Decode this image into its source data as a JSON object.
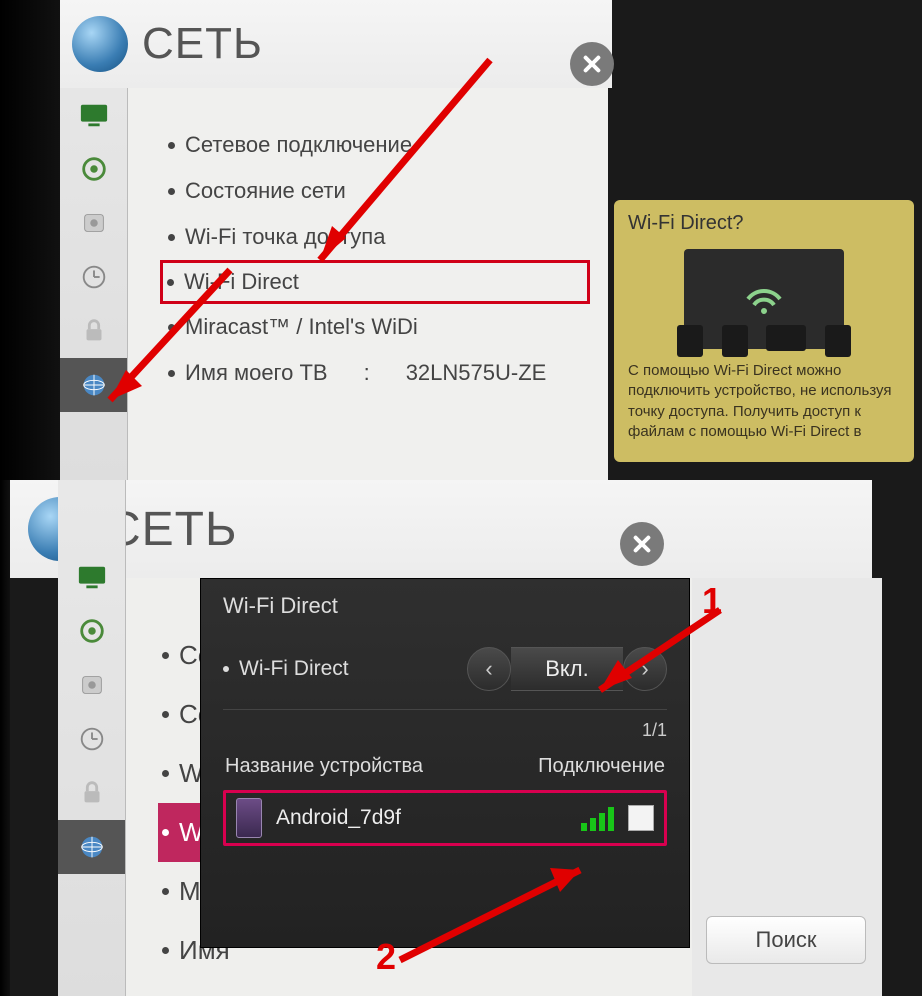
{
  "shot1": {
    "title": "СЕТЬ",
    "menu": [
      "Сетевое подключение",
      "Состояние сети",
      "Wi-Fi точка доступа",
      "Wi-Fi Direct",
      "Miracast™ / Intel's WiDi"
    ],
    "tvname_label": "Имя моего ТВ",
    "tvname_value": "32LN575U-ZE",
    "tooltip": {
      "title": "Wi-Fi Direct?",
      "body": "С помощью Wi-Fi Direct можно подключить устройство, не используя точку доступа. Получить доступ к файлам с помощью Wi-Fi Direct в"
    }
  },
  "shot2": {
    "title": "СЕТЬ",
    "menu_partial": [
      "Сете",
      "Сост",
      "Wi-F",
      "Wi-F",
      "Mira",
      "Имя"
    ],
    "dialog": {
      "title": "Wi-Fi Direct",
      "option_label": "Wi-Fi Direct",
      "toggle_value": "Вкл.",
      "count": "1/1",
      "col_name": "Название устройства",
      "col_conn": "Подключение",
      "device_name": "Android_7d9f"
    },
    "search_btn": "Поиск",
    "anno1": "1",
    "anno2": "2"
  },
  "icons": {
    "globe": "globe-icon",
    "close": "close-icon"
  }
}
